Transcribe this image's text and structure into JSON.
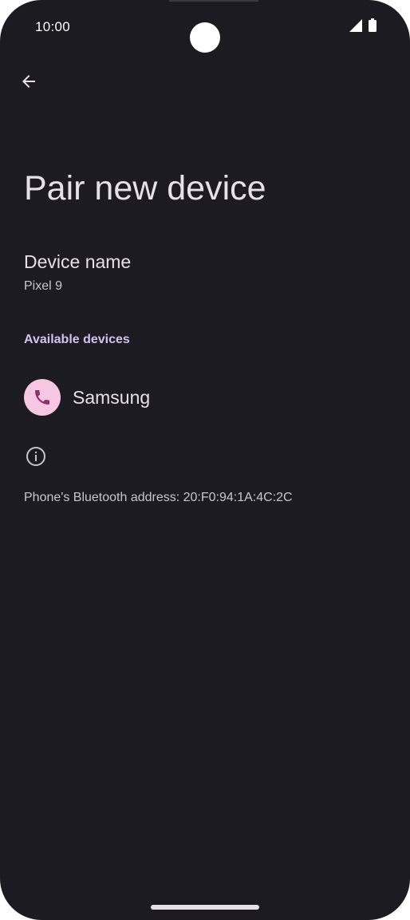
{
  "status_bar": {
    "time": "10:00",
    "icons": [
      "signal-icon",
      "battery-icon"
    ]
  },
  "header": {
    "back_icon": "arrow-back-icon",
    "title": "Pair new device"
  },
  "device_name": {
    "label": "Device name",
    "value": "Pixel 9"
  },
  "available_devices": {
    "header": "Available devices",
    "items": [
      {
        "label": "Samsung",
        "icon": "phone-icon"
      }
    ]
  },
  "footer_info": {
    "icon": "info-icon",
    "text": "Phone's Bluetooth address: 20:F0:94:1A:4C:2C"
  },
  "colors": {
    "background": "#1c1b21",
    "accent": "#d0c3f0",
    "avatar_bg": "#f6c6e2",
    "avatar_icon": "#8c2f6a"
  }
}
